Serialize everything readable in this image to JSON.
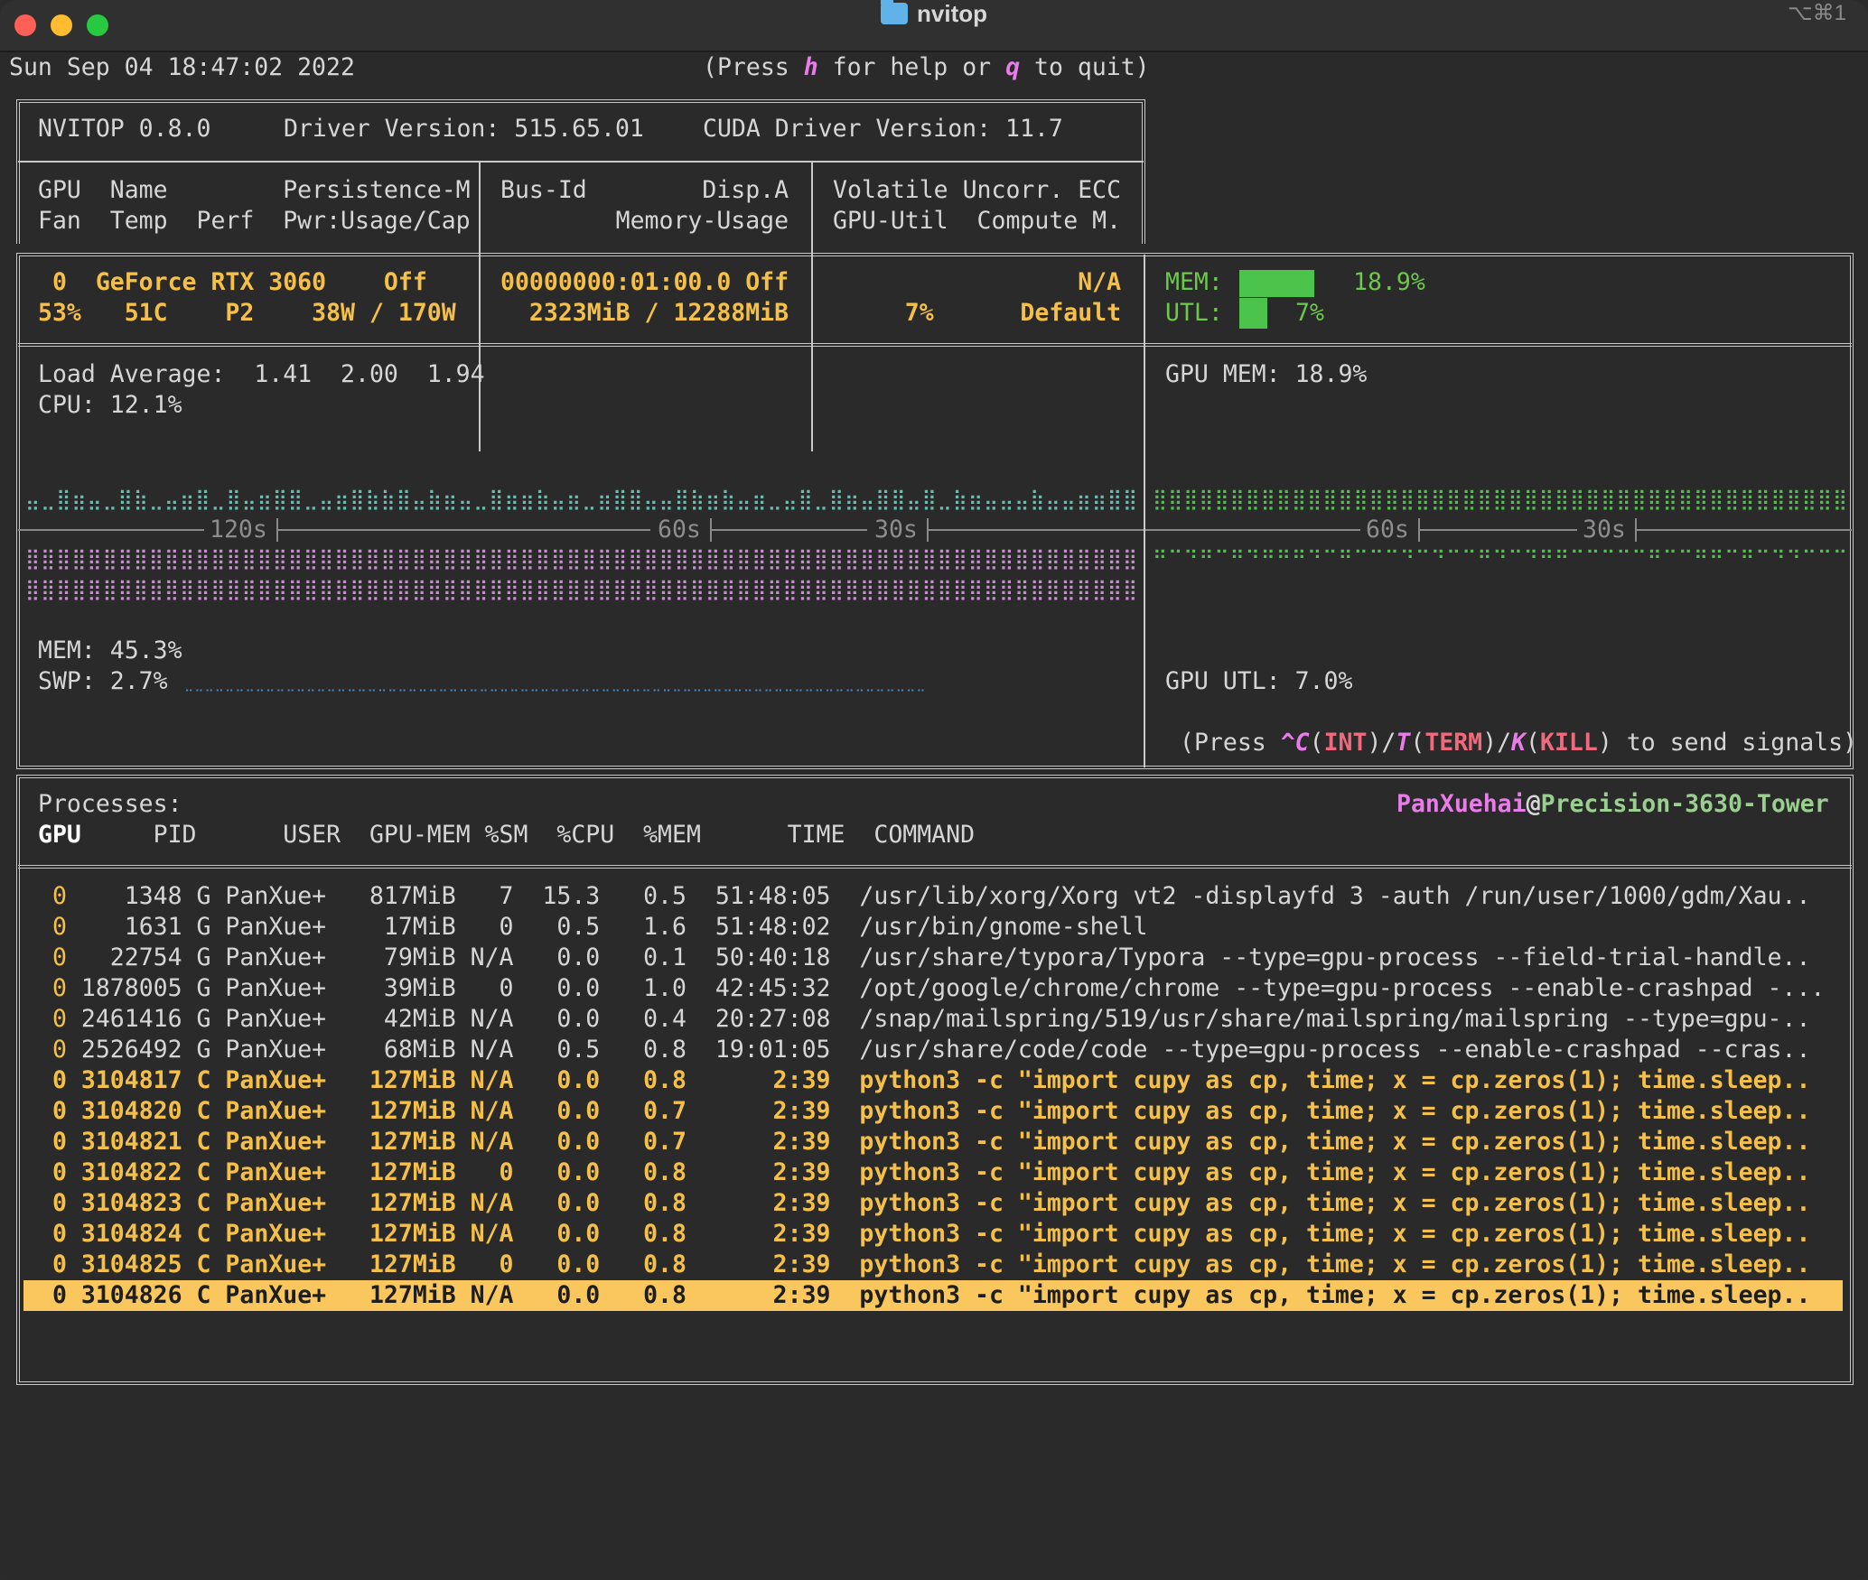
{
  "window": {
    "title": "nvitop",
    "shortcut": "⌥⌘1"
  },
  "header": {
    "datetime": "Sun Sep 04 18:47:02 2022",
    "help_prefix": "(Press ",
    "help_h": "h",
    "help_mid": " for help or ",
    "help_q": "q",
    "help_suffix": " to quit)"
  },
  "info": {
    "nvitop": "NVITOP 0.8.0",
    "driver": "Driver Version: 515.65.01",
    "cuda": "CUDA Driver Version: 11.7"
  },
  "gpu_header": {
    "c1r1": "GPU  Name        Persistence-M",
    "c1r2": "Fan  Temp  Perf  Pwr:Usage/Cap",
    "c2r1": "Bus-Id        Disp.A",
    "c2r2": "        Memory-Usage",
    "c3r1": "Volatile Uncorr. ECC",
    "c3r2": "GPU-Util  Compute M."
  },
  "gpu": {
    "c1r1": " 0  GeForce RTX 3060    Off",
    "c1r2": "53%   51C    P2    38W / 170W",
    "c2r1": "00000000:01:00.0 Off",
    "c2r2": "  2323MiB / 12288MiB",
    "c3r1": "                 N/A",
    "c3r2": "     7%      Default",
    "mem_label": "MEM:",
    "mem_value": "18.9%",
    "mem_fraction": 0.189,
    "utl_label": "UTL:",
    "utl_value": "7%",
    "utl_fraction": 0.07
  },
  "history": {
    "load_avg": "Load Average:  1.41  2.00  1.94",
    "cpu": "CPU: 12.1%",
    "mem": "MEM: 45.3%",
    "swp": "SWP: 2.7%",
    "gpu_mem": "GPU MEM: 18.9%",
    "gpu_utl": "GPU UTL: 7.0%",
    "t120": "120s",
    "t60": "60s",
    "t30": "30s",
    "colors": {
      "cpu": "#5fc2b4",
      "mem": "#c98bd2",
      "swp": "#4e86c6",
      "gpu": "#4cc34a"
    }
  },
  "signals": {
    "p1": "(Press ",
    "c": "^C",
    "p2": "(",
    "int": "INT",
    "p3": ")/",
    "t": "T",
    "p4": "(",
    "term": "TERM",
    "p5": ")/",
    "k": "K",
    "p6": "(",
    "kill": "KILL",
    "p7": ") to send signals)"
  },
  "processes": {
    "title": "Processes:",
    "user": "PanXuehai",
    "at": "@",
    "host": "Precision-3630-Tower",
    "columns": {
      "gpu": "GPU",
      "rest": "     PID      USER  GPU-MEM %SM  %CPU  %MEM      TIME  COMMAND"
    },
    "rows": [
      {
        "gpu": " 0",
        "rest": "    1348 G PanXue+   817MiB   7  15.3   0.5  51:48:05  /usr/lib/xorg/Xorg vt2 -displayfd 3 -auth /run/user/1000/gdm/Xau..",
        "style": "normal"
      },
      {
        "gpu": " 0",
        "rest": "    1631 G PanXue+    17MiB   0   0.5   1.6  51:48:02  /usr/bin/gnome-shell",
        "style": "normal"
      },
      {
        "gpu": " 0",
        "rest": "   22754 G PanXue+    79MiB N/A   0.0   0.1  50:40:18  /usr/share/typora/Typora --type=gpu-process --field-trial-handle..",
        "style": "normal"
      },
      {
        "gpu": " 0",
        "rest": " 1878005 G PanXue+    39MiB   0   0.0   1.0  42:45:32  /opt/google/chrome/chrome --type=gpu-process --enable-crashpad -...",
        "style": "normal"
      },
      {
        "gpu": " 0",
        "rest": " 2461416 G PanXue+    42MiB N/A   0.0   0.4  20:27:08  /snap/mailspring/519/usr/share/mailspring/mailspring --type=gpu-..",
        "style": "normal"
      },
      {
        "gpu": " 0",
        "rest": " 2526492 G PanXue+    68MiB N/A   0.5   0.8  19:01:05  /usr/share/code/code --type=gpu-process --enable-crashpad --cras..",
        "style": "normal"
      },
      {
        "gpu": " 0",
        "rest": " 3104817 C PanXue+   127MiB N/A   0.0   0.8      2:39  python3 -c \"import cupy as cp, time; x = cp.zeros(1); time.sleep..",
        "style": "bold"
      },
      {
        "gpu": " 0",
        "rest": " 3104820 C PanXue+   127MiB N/A   0.0   0.7      2:39  python3 -c \"import cupy as cp, time; x = cp.zeros(1); time.sleep..",
        "style": "bold"
      },
      {
        "gpu": " 0",
        "rest": " 3104821 C PanXue+   127MiB N/A   0.0   0.7      2:39  python3 -c \"import cupy as cp, time; x = cp.zeros(1); time.sleep..",
        "style": "bold"
      },
      {
        "gpu": " 0",
        "rest": " 3104822 C PanXue+   127MiB   0   0.0   0.8      2:39  python3 -c \"import cupy as cp, time; x = cp.zeros(1); time.sleep..",
        "style": "bold"
      },
      {
        "gpu": " 0",
        "rest": " 3104823 C PanXue+   127MiB N/A   0.0   0.8      2:39  python3 -c \"import cupy as cp, time; x = cp.zeros(1); time.sleep..",
        "style": "bold"
      },
      {
        "gpu": " 0",
        "rest": " 3104824 C PanXue+   127MiB N/A   0.0   0.8      2:39  python3 -c \"import cupy as cp, time; x = cp.zeros(1); time.sleep..",
        "style": "bold"
      },
      {
        "gpu": " 0",
        "rest": " 3104825 C PanXue+   127MiB   0   0.0   0.8      2:39  python3 -c \"import cupy as cp, time; x = cp.zeros(1); time.sleep..",
        "style": "bold"
      },
      {
        "gpu": " 0",
        "rest": " 3104826 C PanXue+   127MiB N/A   0.0   0.8      2:39  python3 -c \"import cupy as cp, time; x = cp.zeros(1); time.sleep..",
        "style": "selected"
      }
    ]
  }
}
